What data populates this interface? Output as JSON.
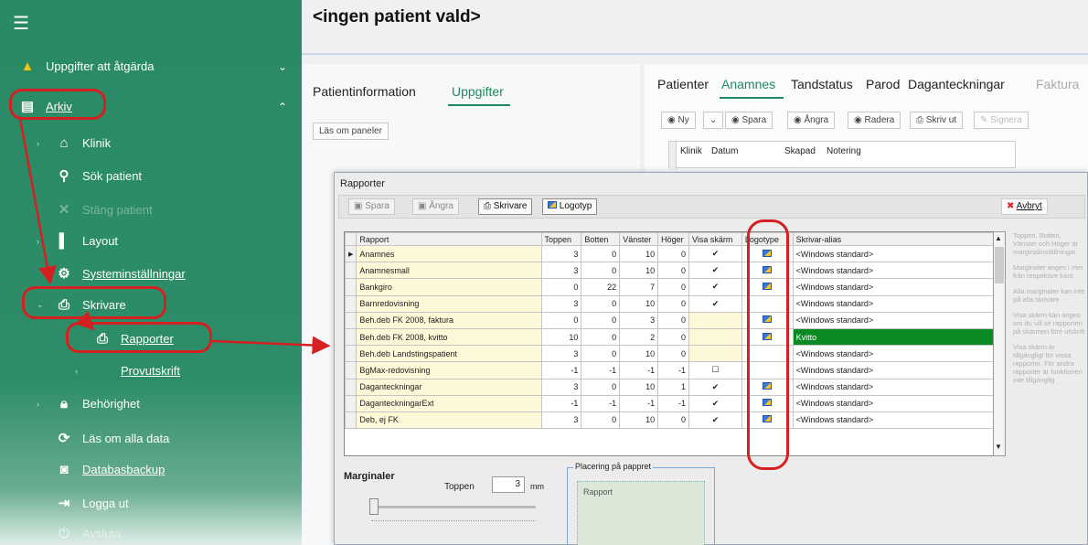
{
  "sidebar": {
    "items": [
      {
        "label": "Uppgifter att åtgärda",
        "icon": "warning-icon"
      },
      {
        "label": "Arkiv",
        "icon": "archive-icon"
      },
      {
        "label": "Klinik",
        "icon": "home-icon"
      },
      {
        "label": "Sök patient",
        "icon": "search-icon"
      },
      {
        "label": "Stäng patient",
        "icon": "close-icon"
      },
      {
        "label": "Layout",
        "icon": "layout-icon"
      },
      {
        "label": "Systeminställningar",
        "icon": "gear-icon"
      },
      {
        "label": "Skrivare",
        "icon": "printer-icon"
      },
      {
        "label": "Rapporter",
        "icon": "printer-icon"
      },
      {
        "label": "Provutskrift",
        "icon": ""
      },
      {
        "label": "Behörighet",
        "icon": "lock-icon"
      },
      {
        "label": "Läs om alla data",
        "icon": "reload-icon"
      },
      {
        "label": "Databasbackup",
        "icon": "database-icon"
      },
      {
        "label": "Logga ut",
        "icon": "logout-icon"
      },
      {
        "label": "Avsluta",
        "icon": "exit-icon"
      }
    ]
  },
  "header": {
    "patient_title": "<ingen patient vald>"
  },
  "left_panel": {
    "tabs": [
      "Patientinformation",
      "Uppgifter"
    ],
    "reload_button": "Läs om paneler"
  },
  "right_panel": {
    "tabs": [
      "Patienter",
      "Anamnes",
      "Tandstatus",
      "Parod",
      "Daganteckningar",
      "Faktura"
    ],
    "toolbar": [
      "Ny",
      "Spara",
      "Ångra",
      "Radera",
      "Skriv ut",
      "Signera"
    ],
    "columns": [
      "Klinik",
      "Datum",
      "Skapad",
      "Notering"
    ]
  },
  "dialog": {
    "title": "Rapporter",
    "toolbar": {
      "spara": "Spara",
      "angra": "Ångra",
      "skrivare": "Skrivare",
      "logotyp": "Logotyp",
      "avbryt": "Avbryt"
    },
    "columns": [
      "Rapport",
      "Toppen",
      "Botten",
      "Vänster",
      "Höger",
      "Visa skärm",
      "Logotype",
      "Skrivar-alias"
    ],
    "rows": [
      {
        "rapport": "Anamnes",
        "toppen": "3",
        "botten": "0",
        "vanster": "10",
        "hoger": "0",
        "visa": "✔",
        "logo": true,
        "alias": "<Windows standard>"
      },
      {
        "rapport": "Anamnesmall",
        "toppen": "3",
        "botten": "0",
        "vanster": "10",
        "hoger": "0",
        "visa": "✔",
        "logo": true,
        "alias": "<Windows standard>"
      },
      {
        "rapport": "Bankgiro",
        "toppen": "0",
        "botten": "22",
        "vanster": "7",
        "hoger": "0",
        "visa": "✔",
        "logo": true,
        "alias": "<Windows standard>"
      },
      {
        "rapport": "Barnredovisning",
        "toppen": "3",
        "botten": "0",
        "vanster": "10",
        "hoger": "0",
        "visa": "✔",
        "logo": false,
        "alias": "<Windows standard>"
      },
      {
        "rapport": "Beh.deb FK 2008, faktura",
        "toppen": "0",
        "botten": "0",
        "vanster": "3",
        "hoger": "0",
        "visa": "",
        "logo": true,
        "alias": "<Windows standard>"
      },
      {
        "rapport": "Beh.deb FK 2008, kvitto",
        "toppen": "10",
        "botten": "0",
        "vanster": "2",
        "hoger": "0",
        "visa": "",
        "logo": true,
        "alias": "Kvitto"
      },
      {
        "rapport": "Beh.deb Landstingspatient",
        "toppen": "3",
        "botten": "0",
        "vanster": "10",
        "hoger": "0",
        "visa": "",
        "logo": false,
        "alias": "<Windows standard>"
      },
      {
        "rapport": "BgMax-redovisning",
        "toppen": "-1",
        "botten": "-1",
        "vanster": "-1",
        "hoger": "-1",
        "visa": "☐",
        "logo": false,
        "alias": "<Windows standard>"
      },
      {
        "rapport": "Daganteckningar",
        "toppen": "3",
        "botten": "0",
        "vanster": "10",
        "hoger": "1",
        "visa": "✔",
        "logo": true,
        "alias": "<Windows standard>"
      },
      {
        "rapport": "DaganteckningarExt",
        "toppen": "-1",
        "botten": "-1",
        "vanster": "-1",
        "hoger": "-1",
        "visa": "✔",
        "logo": true,
        "alias": "<Windows standard>"
      },
      {
        "rapport": "Deb, ej FK",
        "toppen": "3",
        "botten": "0",
        "vanster": "10",
        "hoger": "0",
        "visa": "✔",
        "logo": true,
        "alias": "<Windows standard>"
      }
    ],
    "help": [
      "Toppen, Botten, Vänster och Höger är marginalinställningar",
      "Marginaler anges i mm från respektive kant",
      "Alla marginaler kan inte på alla skrivare",
      "Visa skärm kan anges om du vill se rapporten på skärmen före utskrift",
      "Visa skärm är tillgängligt för vissa rapporter. För andra rapporter är funktionen inte tillgänglig"
    ],
    "margins": {
      "title": "Marginaler",
      "toppen_label": "Toppen",
      "toppen_value": "3",
      "unit": "mm"
    },
    "placement": {
      "title": "Placering på pappret",
      "preview": "Rapport"
    }
  }
}
